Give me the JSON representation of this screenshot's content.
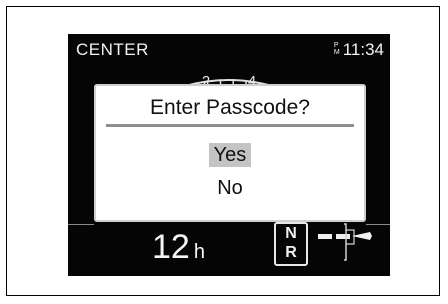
{
  "header": {
    "mode": "CENTER",
    "ampm_top": "P",
    "ampm_bottom": "M",
    "time": "11:34"
  },
  "dial": {
    "labels": [
      "2",
      "4"
    ]
  },
  "dialog": {
    "title": "Enter Passcode?",
    "options": [
      {
        "label": "Yes",
        "selected": true
      },
      {
        "label": "No",
        "selected": false
      }
    ]
  },
  "status": {
    "hours_value": "12",
    "hours_unit": "h",
    "gear_top": "N",
    "gear_bottom": "R"
  },
  "colors": {
    "screen_bg": "#050505",
    "text": "#f2f2f2",
    "selection": "#c4c4c4"
  }
}
